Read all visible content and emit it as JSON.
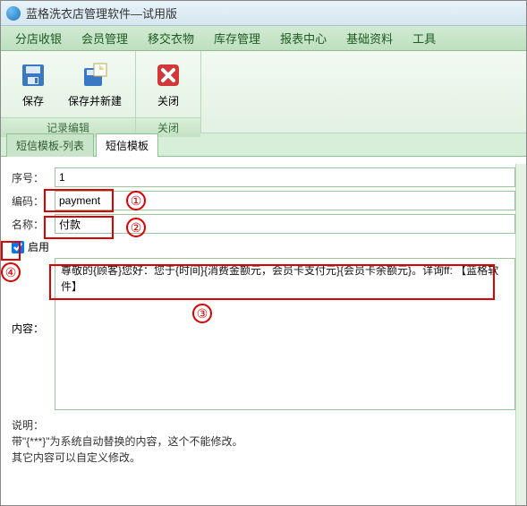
{
  "window": {
    "title": "蓝格洗衣店管理软件—试用版"
  },
  "menu": {
    "items": [
      "分店收银",
      "会员管理",
      "移交衣物",
      "库存管理",
      "报表中心",
      "基础资料",
      "工具"
    ]
  },
  "ribbon": {
    "save": "保存",
    "save_new": "保存并新建",
    "close": "关闭",
    "group_edit": "记录编辑",
    "group_close": "关闭"
  },
  "tabs": {
    "list": "短信模板-列表",
    "form": "短信模板"
  },
  "form": {
    "seq_label": "序号：",
    "seq_value": "1",
    "code_label": "编码：",
    "code_value": "payment",
    "name_label": "名称：",
    "name_value": "付款",
    "enable_label": "启用",
    "enable_checked": true,
    "content_label": "内容：",
    "content_value": "尊敬的{顾客}您好：您于{时间}{消费金额元，会员卡支付元}{会员卡余额元}。详询ff: 【蓝格软件】",
    "explain_label": "说明：",
    "explain_line1": "带\"{***}\"为系统自动替换的内容，这个不能修改。",
    "explain_line2": "其它内容可以自定义修改。"
  },
  "annotations": {
    "n1": "①",
    "n2": "②",
    "n3": "③",
    "n4": "④"
  }
}
